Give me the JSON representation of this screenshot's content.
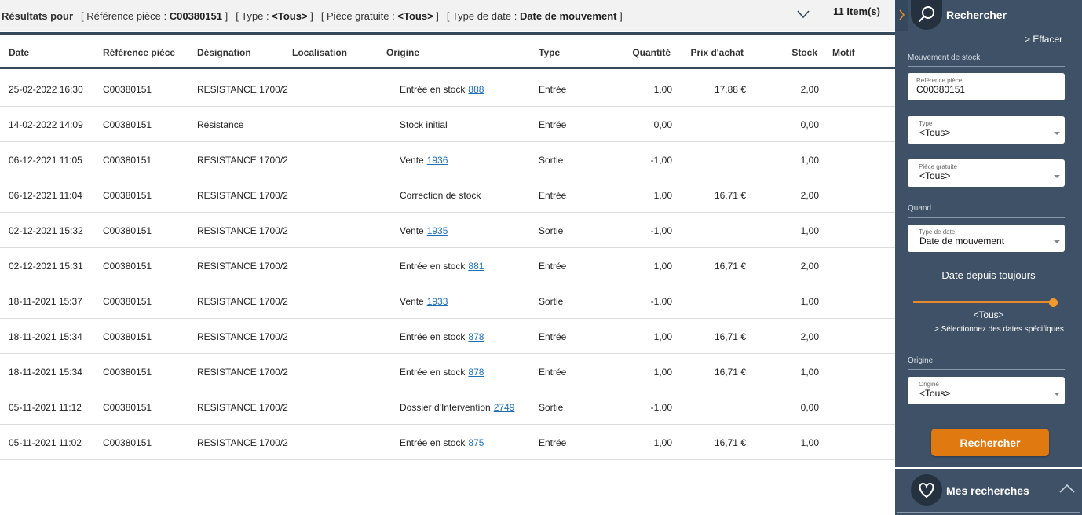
{
  "criteria": {
    "lead": "Résultats pour",
    "ref_label": "[ Référence pièce :",
    "ref_value": "C00380151",
    "type_label": "[ Type :",
    "type_value": "<Tous>",
    "gratuite_label": "[ Pièce gratuite :",
    "gratuite_value": "<Tous>",
    "datetype_label": "[ Type de date :",
    "datetype_value": "Date de mouvement",
    "close": "]",
    "item_count": "11 Item(s)"
  },
  "columns": {
    "date": "Date",
    "ref": "Référence pièce",
    "designation": "Désignation",
    "localisation": "Localisation",
    "origine": "Origine",
    "type": "Type",
    "quantite": "Quantité",
    "prix": "Prix d'achat",
    "stock": "Stock",
    "motif": "Motif"
  },
  "rows": [
    {
      "date": "25-02-2022 16:30",
      "ref": "C00380151",
      "designation": "RESISTANCE 1700/2",
      "origine": "Entrée en stock",
      "link": "888",
      "type": "Entrée",
      "quantite": "1,00",
      "prix": "17,88 €",
      "stock": "2,00"
    },
    {
      "date": "14-02-2022 14:09",
      "ref": "C00380151",
      "designation": "Résistance",
      "origine": "Stock initial",
      "link": "",
      "type": "Entrée",
      "quantite": "0,00",
      "prix": "",
      "stock": "0,00"
    },
    {
      "date": "06-12-2021 11:05",
      "ref": "C00380151",
      "designation": "RESISTANCE 1700/2",
      "origine": "Vente",
      "link": "1936",
      "type": "Sortie",
      "quantite": "-1,00",
      "prix": "",
      "stock": "1,00"
    },
    {
      "date": "06-12-2021 11:04",
      "ref": "C00380151",
      "designation": "RESISTANCE 1700/2",
      "origine": "Correction de stock",
      "link": "",
      "type": "Entrée",
      "quantite": "1,00",
      "prix": "16,71 €",
      "stock": "2,00"
    },
    {
      "date": "02-12-2021 15:32",
      "ref": "C00380151",
      "designation": "RESISTANCE 1700/2",
      "origine": "Vente",
      "link": "1935",
      "type": "Sortie",
      "quantite": "-1,00",
      "prix": "",
      "stock": "1,00"
    },
    {
      "date": "02-12-2021 15:31",
      "ref": "C00380151",
      "designation": "RESISTANCE 1700/2",
      "origine": "Entrée en stock",
      "link": "881",
      "type": "Entrée",
      "quantite": "1,00",
      "prix": "16,71 €",
      "stock": "2,00"
    },
    {
      "date": "18-11-2021 15:37",
      "ref": "C00380151",
      "designation": "RESISTANCE 1700/2",
      "origine": "Vente",
      "link": "1933",
      "type": "Sortie",
      "quantite": "-1,00",
      "prix": "",
      "stock": "1,00"
    },
    {
      "date": "18-11-2021 15:34",
      "ref": "C00380151",
      "designation": "RESISTANCE 1700/2",
      "origine": "Entrée en stock",
      "link": "878",
      "type": "Entrée",
      "quantite": "1,00",
      "prix": "16,71 €",
      "stock": "2,00"
    },
    {
      "date": "18-11-2021 15:34",
      "ref": "C00380151",
      "designation": "RESISTANCE 1700/2",
      "origine": "Entrée en stock",
      "link": "878",
      "type": "Entrée",
      "quantite": "1,00",
      "prix": "16,71 €",
      "stock": "1,00"
    },
    {
      "date": "05-11-2021 11:12",
      "ref": "C00380151",
      "designation": "RESISTANCE 1700/2",
      "origine": "Dossier d'Intervention",
      "link": "2749",
      "type": "Sortie",
      "quantite": "-1,00",
      "prix": "",
      "stock": "0,00"
    },
    {
      "date": "05-11-2021 11:02",
      "ref": "C00380151",
      "designation": "RESISTANCE 1700/2",
      "origine": "Entrée en stock",
      "link": "875",
      "type": "Entrée",
      "quantite": "1,00",
      "prix": "16,71 €",
      "stock": "1,00"
    }
  ],
  "panel": {
    "title": "Rechercher",
    "clear": "> Effacer",
    "section_mouvement": "Mouvement de stock",
    "ref_label": "Référence pièce",
    "ref_value": "C00380151",
    "type_label": "Type",
    "type_value": "<Tous>",
    "gratuite_label": "Pièce gratuite",
    "gratuite_value": "<Tous>",
    "section_quand": "Quand",
    "datetype_label": "Type de date",
    "datetype_value": "Date de mouvement",
    "date_since": "Date depuis toujours",
    "slider_value": "<Tous>",
    "slider_level": 1.0,
    "specific_dates": "> Sélectionnez des dates spécifiques",
    "section_origine": "Origine",
    "origine_label": "Origine",
    "origine_value": "<Tous>",
    "search_button": "Rechercher",
    "saved_searches": "Mes recherches"
  },
  "colors": {
    "panel_bg": "#3e5166",
    "accent_orange": "#e07a10",
    "link_blue": "#1f6fb2",
    "header_bar": "#34495e"
  }
}
